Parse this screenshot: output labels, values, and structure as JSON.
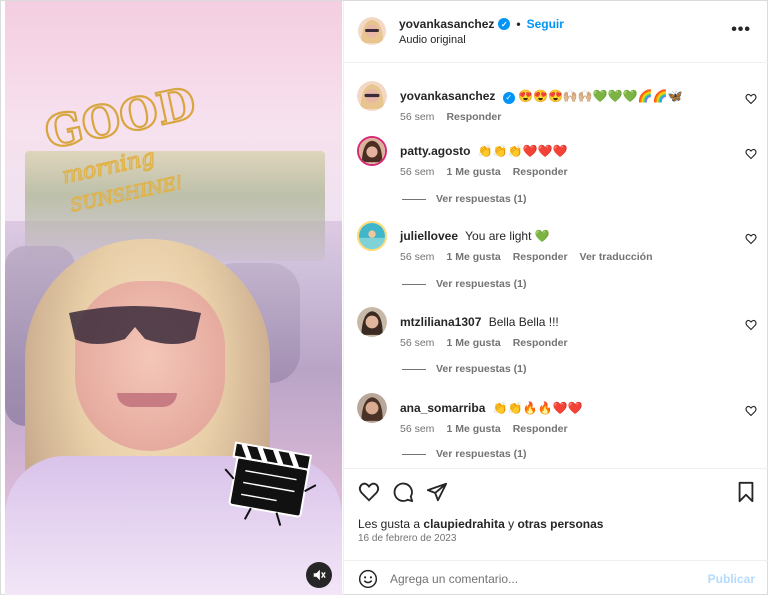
{
  "post": {
    "author": "yovankasanchez",
    "follow_label": "Seguir",
    "dot": "•",
    "audio": "Audio original",
    "more": "•••"
  },
  "media": {
    "sticker_text_1": "GOOD",
    "sticker_text_2": "morning",
    "sticker_text_3": "SUNSHINE!"
  },
  "comments": [
    {
      "user": "yovankasanchez",
      "text": "😍😍😍🙌🏼🙌🏼💚💚💚🌈🌈🦋",
      "time": "56 sem",
      "likes": "",
      "reply": "Responder",
      "translate": "",
      "replies": ""
    },
    {
      "user": "patty.agosto",
      "text": "👏👏👏❤️❤️❤️",
      "time": "56 sem",
      "likes": "1 Me gusta",
      "reply": "Responder",
      "translate": "",
      "replies": "Ver respuestas (1)"
    },
    {
      "user": "juliellovee",
      "text": "You are light 💚",
      "time": "56 sem",
      "likes": "1 Me gusta",
      "reply": "Responder",
      "translate": "Ver traducción",
      "replies": "Ver respuestas (1)"
    },
    {
      "user": "mtzliliana1307",
      "text": "Bella Bella !!!",
      "time": "56 sem",
      "likes": "1 Me gusta",
      "reply": "Responder",
      "translate": "",
      "replies": "Ver respuestas (1)"
    },
    {
      "user": "ana_somarriba",
      "text": "👏👏🔥🔥❤️❤️",
      "time": "56 sem",
      "likes": "1 Me gusta",
      "reply": "Responder",
      "translate": "",
      "replies": "Ver respuestas (1)"
    }
  ],
  "likes": {
    "prefix": "Les gusta a",
    "user": "claupiedrahita",
    "joiner": "y",
    "others": "otras personas"
  },
  "date": "16 de febrero de 2023",
  "add_comment": {
    "placeholder": "Agrega un comentario...",
    "post_label": "Publicar"
  },
  "colors": {
    "accent": "#0095f6",
    "heart": "#ed4956",
    "muted": "#737373",
    "post_disabled": "#b3dbff"
  }
}
